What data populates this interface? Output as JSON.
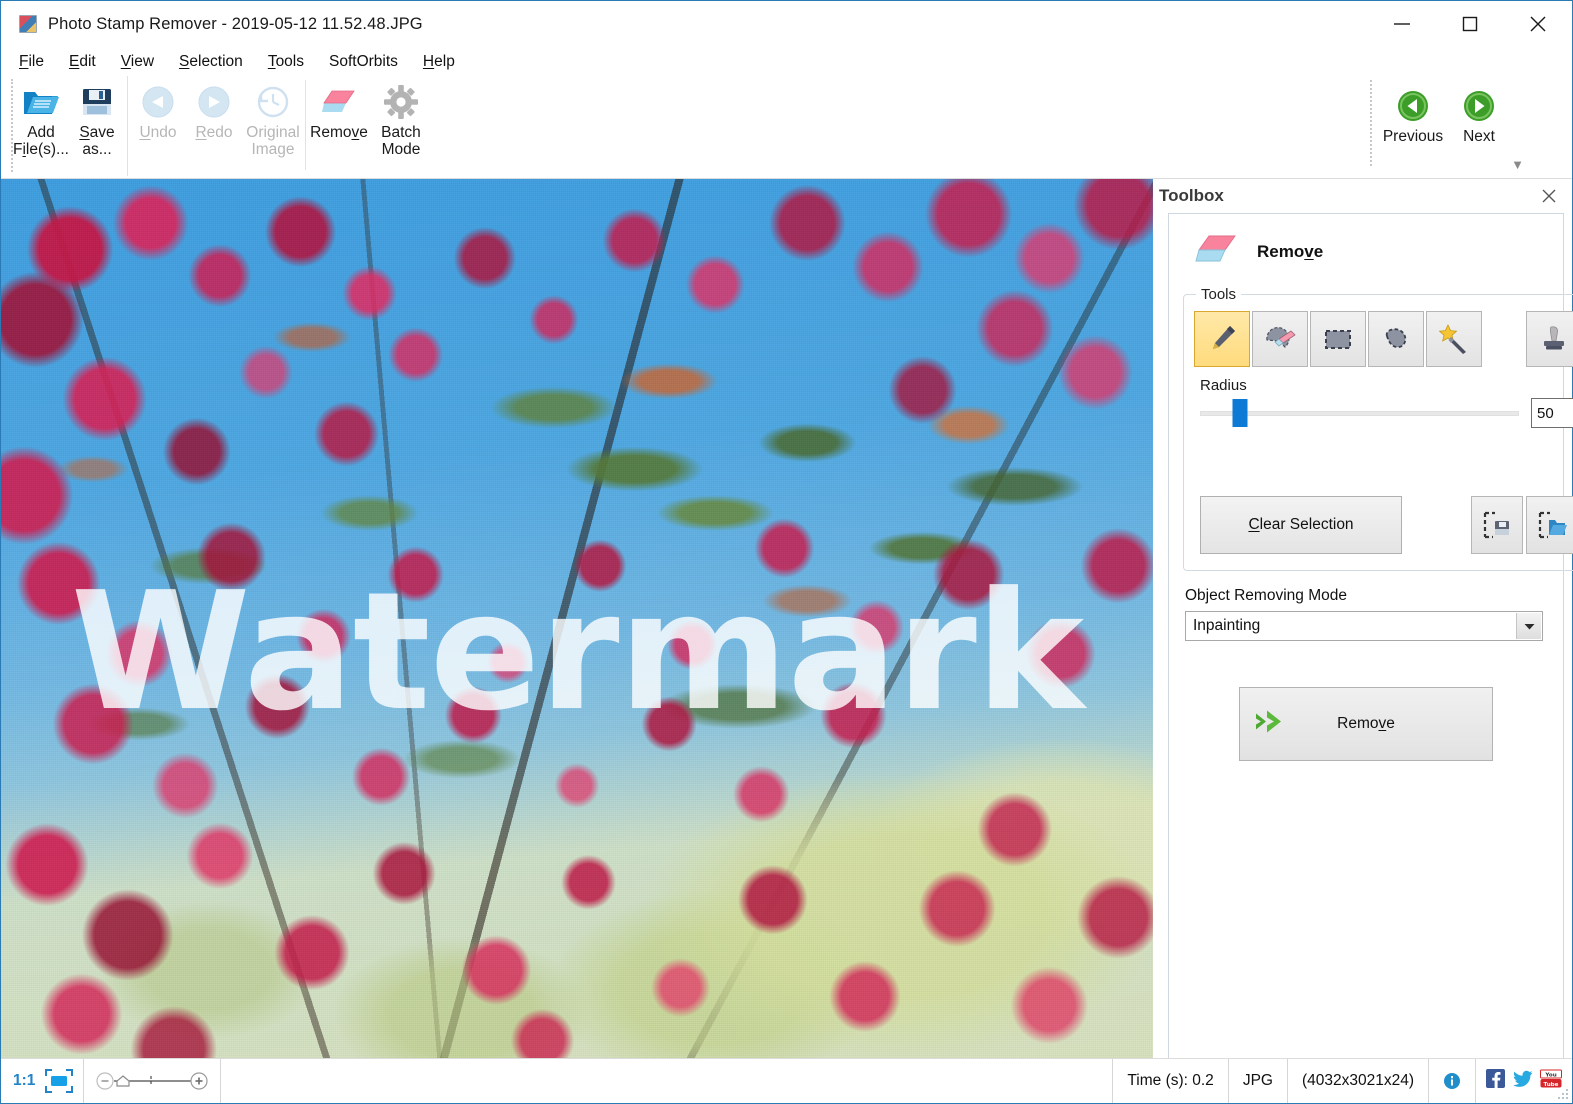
{
  "window": {
    "title": "Photo Stamp Remover - 2019-05-12 11.52.48.JPG",
    "app_icon": "app-icon",
    "minimize": "minimize-icon",
    "maximize": "maximize-icon",
    "close": "close-icon"
  },
  "menubar": {
    "items": [
      {
        "label": "File",
        "accel": "F"
      },
      {
        "label": "Edit",
        "accel": "E"
      },
      {
        "label": "View",
        "accel": "V"
      },
      {
        "label": "Selection",
        "accel": "S"
      },
      {
        "label": "Tools",
        "accel": "T"
      },
      {
        "label": "SoftOrbits",
        "accel": ""
      },
      {
        "label": "Help",
        "accel": "H"
      }
    ]
  },
  "toolbar": {
    "add_files": "Add\nFile(s)...",
    "save_as": "Save\nas...",
    "undo": "Undo",
    "redo": "Redo",
    "original_image": "Original\nImage",
    "remove": "Remove",
    "batch_mode": "Batch\nMode",
    "previous": "Previous",
    "next": "Next",
    "expand_caret": "▼"
  },
  "canvas": {
    "watermark_text": "Watermark",
    "image_name": "2019-05-12 11.52.48.JPG"
  },
  "toolbox": {
    "panel_title": "Toolbox",
    "close_label": "close-icon",
    "mode_title": "Remove",
    "tools_group_label": "Tools",
    "tools": [
      {
        "name": "marker-tool",
        "icon": "pencil-marker-icon",
        "selected": true
      },
      {
        "name": "eraser-tool",
        "icon": "eraser-icon",
        "selected": false
      },
      {
        "name": "rectangle-select-tool",
        "icon": "rectangle-selection-icon",
        "selected": false
      },
      {
        "name": "lasso-tool",
        "icon": "lasso-icon",
        "selected": false
      },
      {
        "name": "magic-wand-tool",
        "icon": "magic-wand-icon",
        "selected": false
      },
      {
        "name": "stamp-tool",
        "icon": "stamp-icon",
        "selected": false
      }
    ],
    "radius": {
      "label": "Radius",
      "value": "50",
      "percent": 12.5,
      "min": 1,
      "max": 400
    },
    "clear_selection": "Clear Selection",
    "clear_selection_accel": "C",
    "save_selection_icon": "save-selection-icon",
    "load_selection_icon": "load-selection-icon",
    "object_removing_mode": {
      "label": "Object Removing Mode",
      "value": "Inpainting",
      "options": [
        "Inpainting"
      ]
    },
    "remove_button": {
      "label": "Remove",
      "accel": "v",
      "icon": "green-double-arrow-icon"
    }
  },
  "statusbar": {
    "zoom_ratio": "1:1",
    "fit_icon": "fit-to-screen-icon",
    "zoom_out_icon": "zoom-out-icon",
    "home_icon": "home-zoom-icon",
    "zoom_in_icon": "zoom-in-icon",
    "time": "Time (s): 0.2",
    "format": "JPG",
    "dimensions": "(4032x3021x24)",
    "info_icon": "info-icon",
    "facebook_icon": "facebook-icon",
    "twitter_icon": "twitter-icon",
    "youtube_icon": "youtube-icon"
  },
  "colors": {
    "window_border": "#2a7bb5",
    "accent_blue": "#0d7ad6",
    "selected_tool": "#ffdb7d",
    "green_nav": "#3c9e29",
    "status_link": "#2184c8"
  }
}
